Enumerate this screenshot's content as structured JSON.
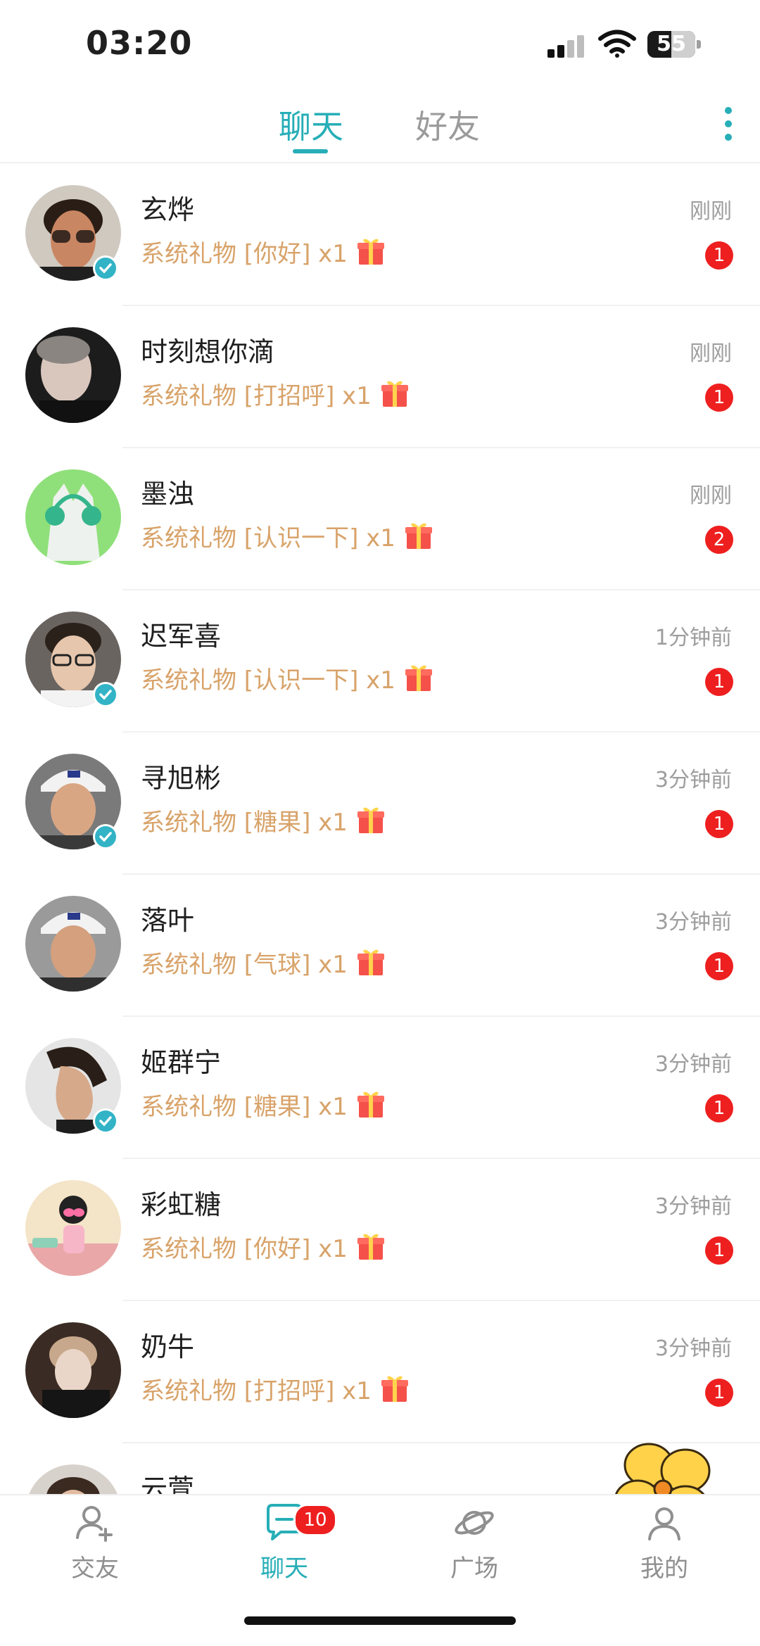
{
  "status_bar": {
    "time": "03:20",
    "battery": "55"
  },
  "header": {
    "tabs": [
      {
        "label": "聊天",
        "active": true
      },
      {
        "label": "好友",
        "active": false
      }
    ]
  },
  "conversations": [
    {
      "name": "玄烨",
      "message": "系统礼物 [你好] x1",
      "time": "刚刚",
      "unread": "1",
      "verified": true
    },
    {
      "name": "时刻想你滴",
      "message": "系统礼物 [打招呼] x1",
      "time": "刚刚",
      "unread": "1",
      "verified": false
    },
    {
      "name": "墨浊",
      "message": "系统礼物 [认识一下] x1",
      "time": "刚刚",
      "unread": "2",
      "verified": false
    },
    {
      "name": "迟军喜",
      "message": "系统礼物 [认识一下] x1",
      "time": "1分钟前",
      "unread": "1",
      "verified": true
    },
    {
      "name": "寻旭彬",
      "message": "系统礼物 [糖果] x1",
      "time": "3分钟前",
      "unread": "1",
      "verified": true
    },
    {
      "name": "落叶",
      "message": "系统礼物 [气球] x1",
      "time": "3分钟前",
      "unread": "1",
      "verified": false
    },
    {
      "name": "姬群宁",
      "message": "系统礼物 [糖果] x1",
      "time": "3分钟前",
      "unread": "1",
      "verified": true
    },
    {
      "name": "彩虹糖",
      "message": "系统礼物 [你好] x1",
      "time": "3分钟前",
      "unread": "1",
      "verified": false
    },
    {
      "name": "奶牛",
      "message": "系统礼物 [打招呼] x1",
      "time": "3分钟前",
      "unread": "1",
      "verified": false
    },
    {
      "name": "云萱",
      "message": "",
      "time": "",
      "unread": "",
      "verified": false
    }
  ],
  "tab_bar": {
    "items": [
      {
        "label": "交友",
        "icon": "add-friend-icon",
        "active": false
      },
      {
        "label": "聊天",
        "icon": "chat-bubble-icon",
        "active": true,
        "badge": "10"
      },
      {
        "label": "广场",
        "icon": "planet-icon",
        "active": false
      },
      {
        "label": "我的",
        "icon": "profile-icon",
        "active": false
      }
    ]
  },
  "colors": {
    "accent": "#27aeb7",
    "gift_text": "#d8a36a",
    "badge": "#ee1f1f",
    "verified": "#32b3c6"
  }
}
